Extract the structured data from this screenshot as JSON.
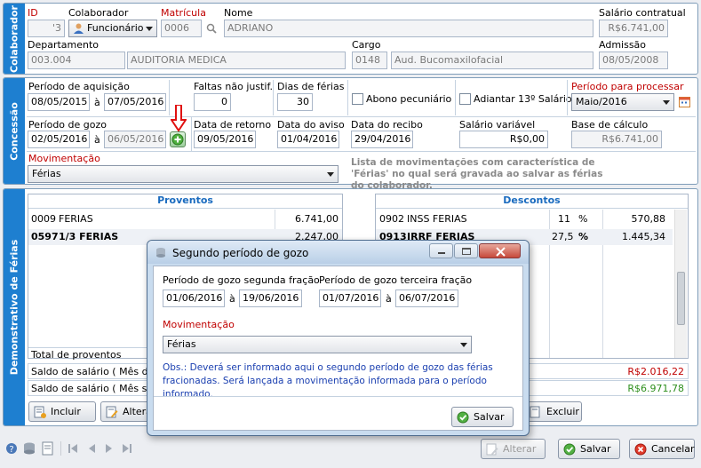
{
  "colaborador": {
    "tab": "Colaborador",
    "id_label": "ID",
    "id_value": "'3",
    "colaborador_label": "Colaborador",
    "colaborador_type": "Funcionário",
    "matricula_label": "Matrícula",
    "matricula_value": "0006",
    "nome_label": "Nome",
    "nome_value": "ADRIANO",
    "salario_label": "Salário contratual",
    "salario_value": "R$6.741,00",
    "departamento_label": "Departamento",
    "departamento_code": "003.004",
    "departamento_name": "AUDITORIA MEDICA",
    "cargo_label": "Cargo",
    "cargo_code": "0148",
    "cargo_name": "Aud. Bucomaxilofacial",
    "admissao_label": "Admissão",
    "admissao_value": "08/05/2008"
  },
  "concessao": {
    "tab": "Concessão",
    "aquisicao_label": "Período de aquisição",
    "aquisicao_de": "08/05/2015",
    "aquisicao_ate": "07/05/2016",
    "a_sep": "à",
    "faltas_label": "Faltas não justif.",
    "faltas_value": "0",
    "dias_label": "Dias de férias",
    "dias_value": "30",
    "abono_label": "Abono pecuniário",
    "adiantar_label": "Adiantar 13º Salário",
    "periodo_proc_label": "Período para processar",
    "periodo_proc_value": "Maio/2016",
    "gozo_label": "Período de gozo",
    "gozo_de": "02/05/2016",
    "gozo_ate": "06/05/2016",
    "retorno_label": "Data de retorno",
    "retorno_value": "09/05/2016",
    "aviso_label": "Data do aviso",
    "aviso_value": "01/04/2016",
    "recibo_label": "Data do recibo",
    "recibo_value": "29/04/2016",
    "salario_var_label": "Salário variável",
    "salario_var_value": "R$0,00",
    "base_label": "Base de cálculo",
    "base_value": "R$6.741,00",
    "mov_label": "Movimentação",
    "mov_value": "Férias",
    "mov_note": "Lista de movimentações com característica de 'Férias' no qual será gravada ao salvar as férias do colaborador."
  },
  "demonstrativo": {
    "tab": "Demonstrativo de Férias",
    "proventos_header": "Proventos",
    "descontos_header": "Descontos",
    "proventos": [
      {
        "code": "0009",
        "desc": "FERIAS",
        "value": "6.741,00"
      },
      {
        "code": "0597",
        "desc": "1/3 FERIAS",
        "value": "2.247,00"
      }
    ],
    "descontos": [
      {
        "code": "0902",
        "desc": "INSS FERIAS",
        "pct": "11",
        "pct_sign": "%",
        "value": "570,88"
      },
      {
        "code": "0913",
        "desc": "IRRF FERIAS",
        "pct": "27,5",
        "pct_sign": "%",
        "value": "1.445,34"
      }
    ],
    "total_proventos": "Total de proventos",
    "saldo1_label": "Saldo de salário ( Mês de férias )",
    "saldo1_value": "R$2.016,22",
    "saldo2_label": "Saldo de salário ( Mês seguinte )",
    "saldo2_value": "R$6.971,78",
    "incluir": "Incluir",
    "alterar": "Alterar",
    "excluir": "Excluir"
  },
  "dialog": {
    "title": "Segundo período de gozo",
    "seg_label": "Período de gozo segunda fração",
    "seg_de": "01/06/2016",
    "seg_ate": "19/06/2016",
    "ter_label": "Período de gozo terceira fração",
    "ter_de": "01/07/2016",
    "ter_ate": "06/07/2016",
    "a_sep": "à",
    "mov_label": "Movimentação",
    "mov_value": "Férias",
    "obs": "Obs.: Deverá ser informado aqui o segundo período de gozo das férias fracionadas. Será lançada a movimentação informada para o período informado.",
    "salvar": "Salvar"
  },
  "footer": {
    "alterar": "Alterar",
    "salvar": "Salvar",
    "cancelar": "Cancelar"
  }
}
